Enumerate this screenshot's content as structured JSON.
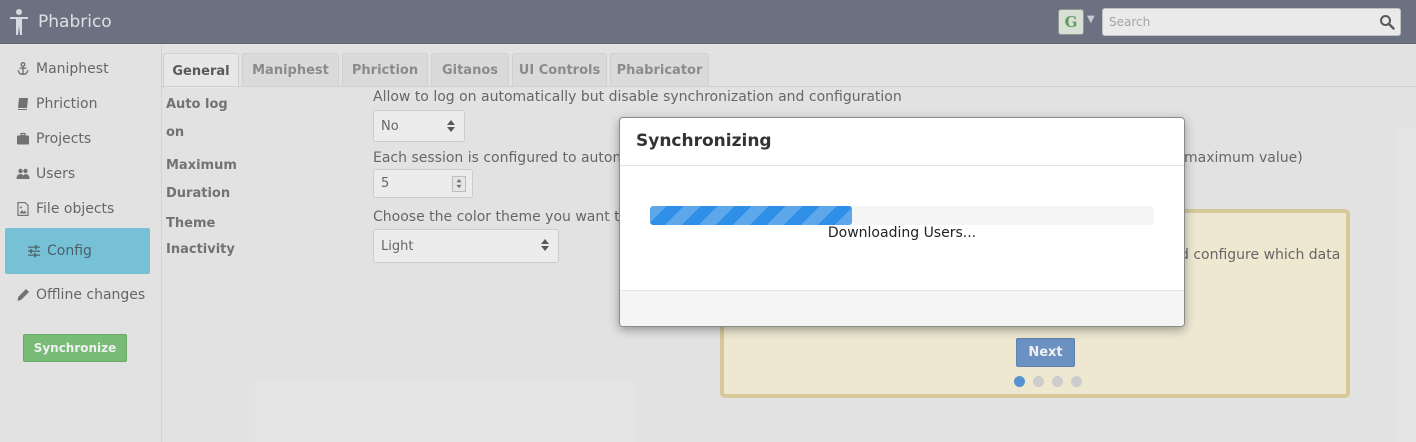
{
  "header": {
    "brand": "Phabrico",
    "user_initial": "G",
    "search_placeholder": "Search"
  },
  "sidebar": {
    "items": [
      {
        "label": "Maniphest",
        "icon": "anchor-icon"
      },
      {
        "label": "Phriction",
        "icon": "book-icon"
      },
      {
        "label": "Projects",
        "icon": "briefcase-icon"
      },
      {
        "label": "Users",
        "icon": "users-icon"
      },
      {
        "label": "File objects",
        "icon": "file-image-icon"
      },
      {
        "label": "Config",
        "icon": "sliders-icon"
      },
      {
        "label": "Offline changes",
        "icon": "pencil-icon"
      }
    ],
    "sync_label": "Synchronize"
  },
  "tabs": [
    "General",
    "Maniphest",
    "Phriction",
    "Gitanos",
    "UI Controls",
    "Phabricator"
  ],
  "settings": {
    "auto_logon": {
      "label_1": "Auto log",
      "label_2": "on",
      "description": "Allow to log on automatically but disable synchronization and configuration",
      "value": "No"
    },
    "max_duration": {
      "label_1": "Maximum",
      "label_2": "Duration",
      "label_3": "Inactivity",
      "description": "Each session is configured to automa",
      "description_right": "maximum value)",
      "value": "5"
    },
    "theme": {
      "label": "Theme",
      "description": "Choose the color theme you want to u",
      "value": "Light"
    }
  },
  "tour": {
    "text": "d configure which data",
    "next_label": "Next",
    "step_count": 4,
    "active_step": 1
  },
  "modal": {
    "title": "Synchronizing",
    "progress_fraction": 0.4,
    "status": "Downloading Users..."
  },
  "colors": {
    "header_bg": "#4b5468",
    "active_nav": "#5bc0de",
    "sync_button": "#5cb85c",
    "progress": "#2f8ee5",
    "next_button": "#4a7fc0"
  }
}
